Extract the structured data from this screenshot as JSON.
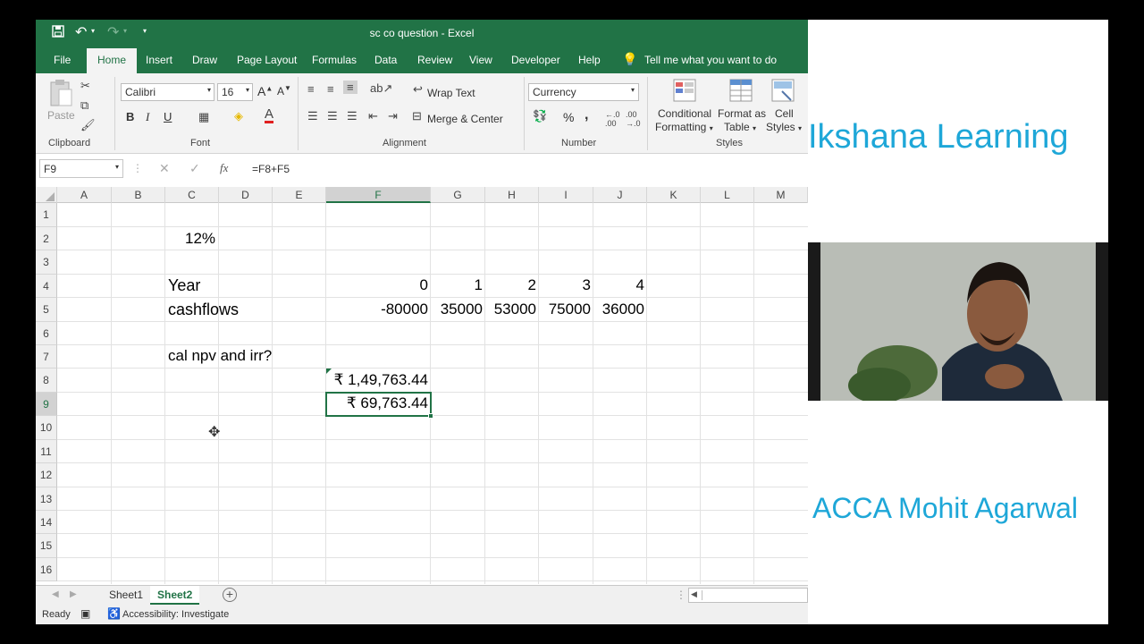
{
  "titlebar": {
    "title": "sc co question  -  Excel"
  },
  "ribbon_tabs": [
    "File",
    "Home",
    "Insert",
    "Draw",
    "Page Layout",
    "Formulas",
    "Data",
    "Review",
    "View",
    "Developer",
    "Help"
  ],
  "tell_me": "Tell me what you want to do",
  "ribbon": {
    "clipboard": {
      "paste": "Paste",
      "label": "Clipboard"
    },
    "font": {
      "name": "Calibri",
      "size": "16",
      "label": "Font",
      "bold": "B",
      "italic": "I",
      "underline": "U"
    },
    "alignment": {
      "wrap": "Wrap Text",
      "merge": "Merge & Center",
      "label": "Alignment"
    },
    "number": {
      "format": "Currency",
      "label": "Number",
      "percent": "%",
      "comma": ","
    },
    "styles": {
      "conditional1": "Conditional",
      "conditional2": "Formatting",
      "table1": "Format as",
      "table2": "Table",
      "cell1": "Cell",
      "cell2": "Styles",
      "label": "Styles"
    }
  },
  "formula_bar": {
    "name_box": "F9",
    "fx": "fx",
    "formula": "=F8+F5"
  },
  "columns": [
    "A",
    "B",
    "C",
    "D",
    "E",
    "F",
    "G",
    "H",
    "I",
    "J",
    "K",
    "L",
    "M"
  ],
  "rows": [
    "1",
    "2",
    "3",
    "4",
    "5",
    "6",
    "7",
    "8",
    "9",
    "10",
    "11",
    "12",
    "13",
    "14",
    "15",
    "16"
  ],
  "cells": {
    "C2": "12%",
    "C4": "Year",
    "C5": "cashflows",
    "C7": "cal npv and irr?",
    "F4": "0",
    "G4": "1",
    "H4": "2",
    "I4": "3",
    "J4": "4",
    "F5": "-80000",
    "G5": "35000",
    "H5": "53000",
    "I5": "75000",
    "J5": "36000",
    "F8": "₹ 1,49,763.44",
    "F9": "₹ 69,763.44"
  },
  "sheets": [
    "Sheet1",
    "Sheet2"
  ],
  "status": {
    "ready": "Ready",
    "accessibility": "Accessibility: Investigate"
  },
  "panel": {
    "brand": "Ikshana Learning",
    "author": "ACCA Mohit Agarwal"
  },
  "colors": {
    "excel_green": "#217346",
    "brand_blue": "#1ea7d8"
  }
}
